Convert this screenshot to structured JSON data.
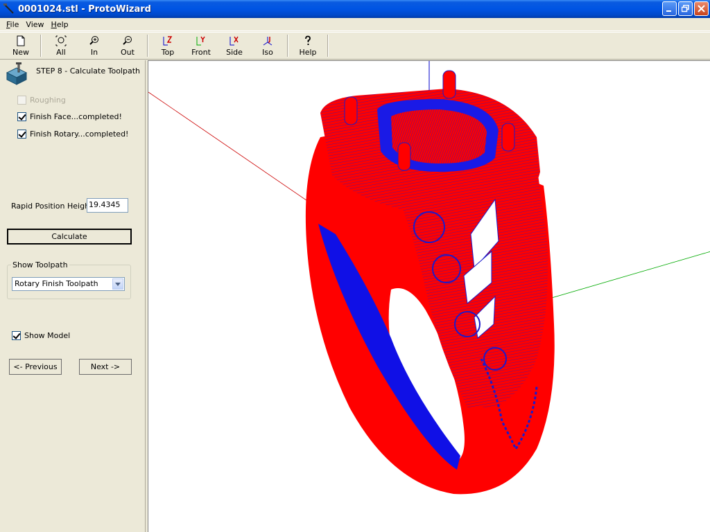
{
  "window": {
    "title": "0001024.stl - ProtoWizard"
  },
  "menu": [
    {
      "label": "File",
      "underline": "F",
      "rest": "ile"
    },
    {
      "label": "View",
      "underline": "",
      "rest": "View"
    },
    {
      "label": "Help",
      "underline": "H",
      "rest": "elp"
    }
  ],
  "toolbar": {
    "new": "New",
    "all": "All",
    "in": "In",
    "out": "Out",
    "top": "Top",
    "front": "Front",
    "side": "Side",
    "iso": "Iso",
    "help": "Help"
  },
  "panel": {
    "step_title": "STEP 8 - Calculate Toolpath",
    "roughing": {
      "label": "Roughing",
      "checked": false,
      "enabled": false
    },
    "finish_face": {
      "label": "Finish Face...completed!",
      "checked": true
    },
    "finish_rotary": {
      "label": "Finish Rotary...completed!",
      "checked": true
    },
    "rapid_label": "Rapid Position Height:",
    "rapid_value": "19.4345",
    "calculate": "Calculate",
    "show_toolpath_label": "Show Toolpath",
    "show_toolpath_value": "Rotary Finish Toolpath",
    "show_model": {
      "label": "Show Model",
      "checked": true
    },
    "previous": "<- Previous",
    "next": "Next ->"
  },
  "colors": {
    "toolpath": "#ff0000",
    "model": "#0000ff",
    "axis_x": "#cc0000",
    "axis_y": "#00aa00",
    "axis_z": "#0000cc"
  }
}
